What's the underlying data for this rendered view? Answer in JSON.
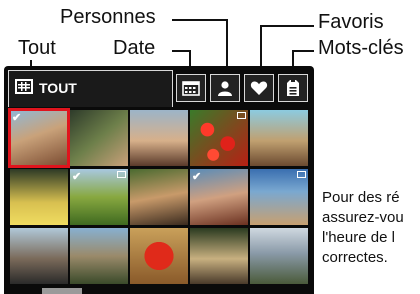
{
  "callouts": {
    "tout": "Tout",
    "personnes": "Personnes",
    "date": "Date",
    "favoris": "Favoris",
    "mots_cles": "Mots-clés"
  },
  "tabs": {
    "tout_label": "TOUT",
    "date_icon": "calendar-icon",
    "personnes_icon": "person-icon",
    "favoris_icon": "heart-icon",
    "mots_cles_icon": "tag-icon"
  },
  "thumbnails": [
    {
      "id": "couple-selfie",
      "checked": true,
      "selected": true
    },
    {
      "id": "couple-kissing",
      "checked": false,
      "selected": false
    },
    {
      "id": "family-group",
      "checked": false,
      "selected": false
    },
    {
      "id": "red-tomatoes",
      "checked": false,
      "selected": false,
      "flag": true
    },
    {
      "id": "woman-beach",
      "checked": false,
      "selected": false
    },
    {
      "id": "man-yellow-shirt",
      "checked": false,
      "selected": false
    },
    {
      "id": "grassy-field",
      "checked": true,
      "selected": false,
      "flag": true
    },
    {
      "id": "woman-smiling",
      "checked": false,
      "selected": false
    },
    {
      "id": "woman-sunset",
      "checked": true,
      "selected": false
    },
    {
      "id": "man-beach",
      "checked": false,
      "selected": false,
      "flag": true
    },
    {
      "id": "boat-crowd",
      "checked": false,
      "selected": false
    },
    {
      "id": "friends-group",
      "checked": false,
      "selected": false
    },
    {
      "id": "red-leaf",
      "checked": false,
      "selected": false
    },
    {
      "id": "men-outdoor",
      "checked": false,
      "selected": false
    },
    {
      "id": "landscape",
      "checked": false,
      "selected": false
    }
  ],
  "colors": {
    "selection": "#e0141d",
    "device_bg": "#0a0a0a"
  },
  "note": {
    "line1": "Pour des ré",
    "line2": "assurez-vou",
    "line3": "l'heure de l",
    "line4": "correctes."
  }
}
